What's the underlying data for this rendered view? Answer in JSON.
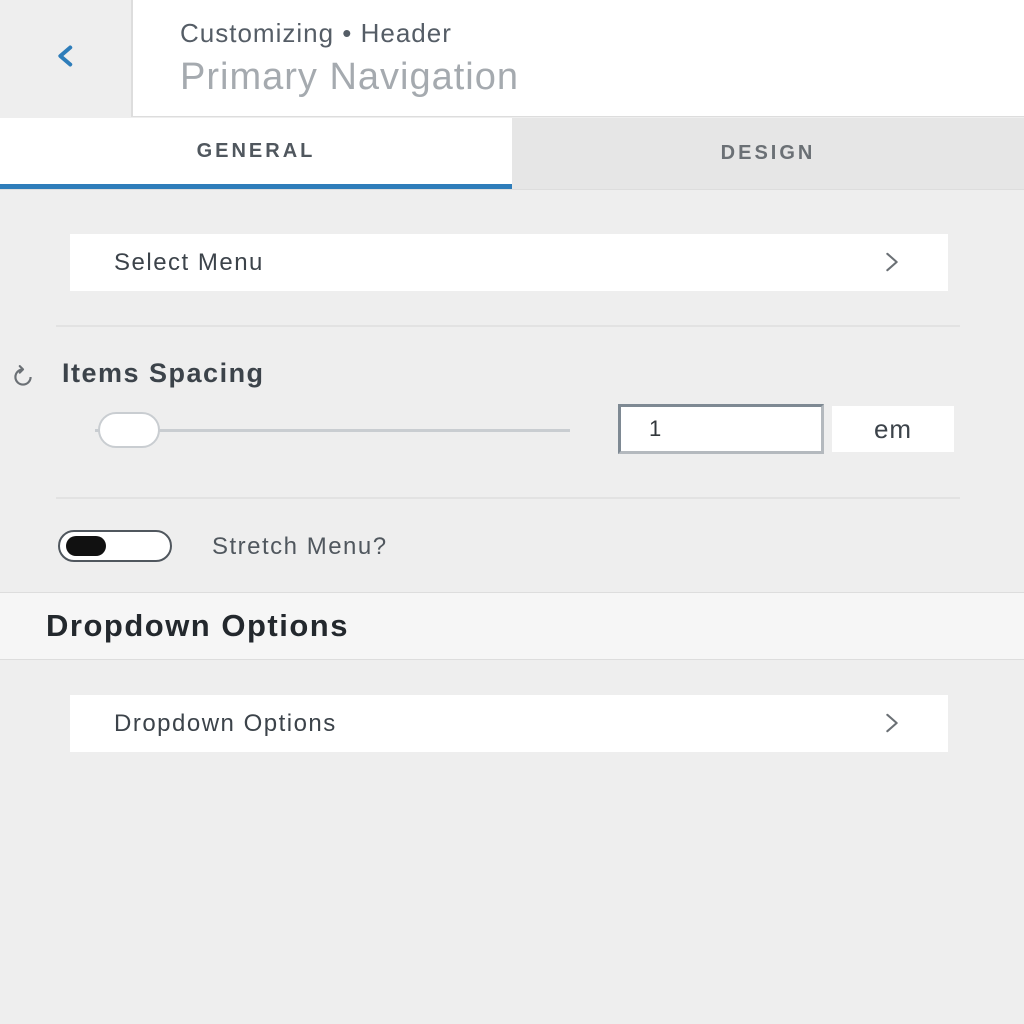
{
  "header": {
    "back_icon": "chevron-left-icon",
    "breadcrumb": "Customizing • Header",
    "title": "Primary Navigation"
  },
  "tabs": [
    {
      "label": "General",
      "active": true
    },
    {
      "label": "Design",
      "active": false
    }
  ],
  "select_menu": {
    "label": "Select Menu",
    "icon": "chevron-right-icon"
  },
  "items_spacing": {
    "reset_icon": "reset-icon",
    "label": "Items Spacing",
    "value": "1",
    "unit": "em",
    "slider_fraction": 0
  },
  "stretch_menu": {
    "label": "Stretch Menu?",
    "enabled": false
  },
  "dropdown_section": {
    "title": "Dropdown Options",
    "row_label": "Dropdown Options",
    "icon": "chevron-right-icon"
  },
  "colors": {
    "accent": "#2e7dba",
    "background": "#eeeeee",
    "panel": "#ffffff"
  }
}
